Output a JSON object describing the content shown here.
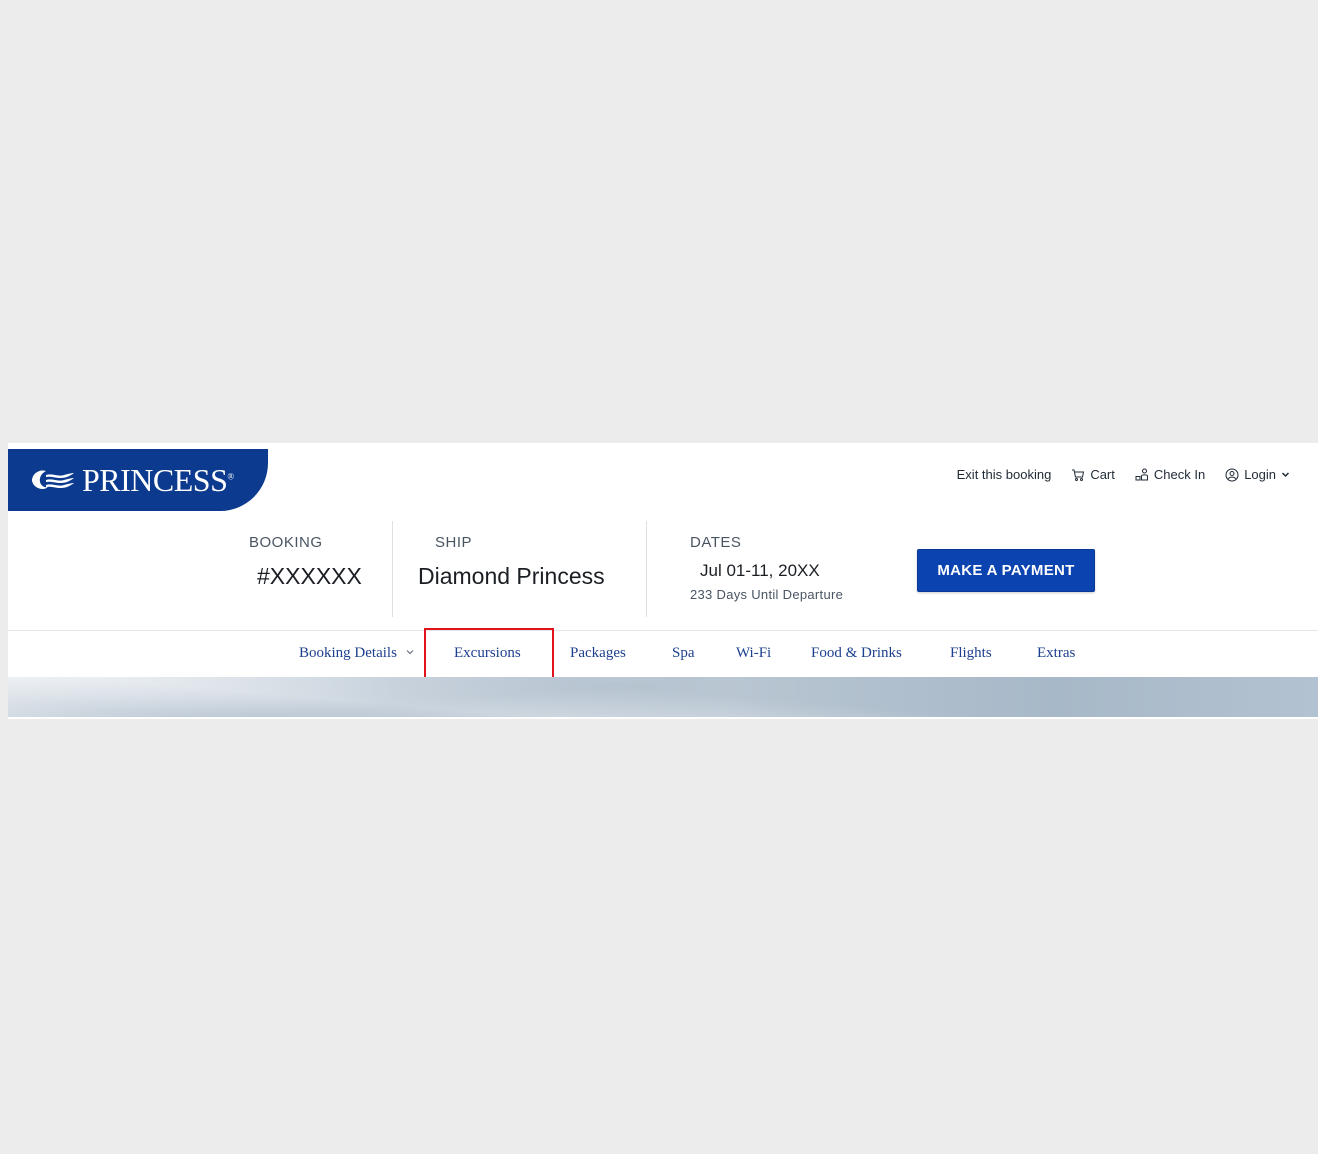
{
  "brand": {
    "name": "PRINCESS",
    "trademark": "®",
    "color": "#0b3a8f"
  },
  "utility_nav": {
    "exit": "Exit this booking",
    "cart": "Cart",
    "checkin": "Check In",
    "login": "Login"
  },
  "summary": {
    "booking_label": "BOOKING",
    "booking_value": "#XXXXXX",
    "ship_label": "SHIP",
    "ship_value": "Diamond Princess",
    "dates_label": "DATES",
    "dates_value": "Jul 01-11, 20XX",
    "countdown": "233 Days Until Departure",
    "pay_button": "MAKE A PAYMENT"
  },
  "tabs": [
    {
      "label": "Booking Details"
    },
    {
      "label": "Excursions",
      "highlighted": true
    },
    {
      "label": "Packages"
    },
    {
      "label": "Spa"
    },
    {
      "label": "Wi-Fi"
    },
    {
      "label": "Food & Drinks"
    },
    {
      "label": "Flights"
    },
    {
      "label": "Extras"
    }
  ],
  "colors": {
    "accent": "#0b44b0",
    "tab_text": "#1d3f8f",
    "highlight": "#e0141a"
  }
}
